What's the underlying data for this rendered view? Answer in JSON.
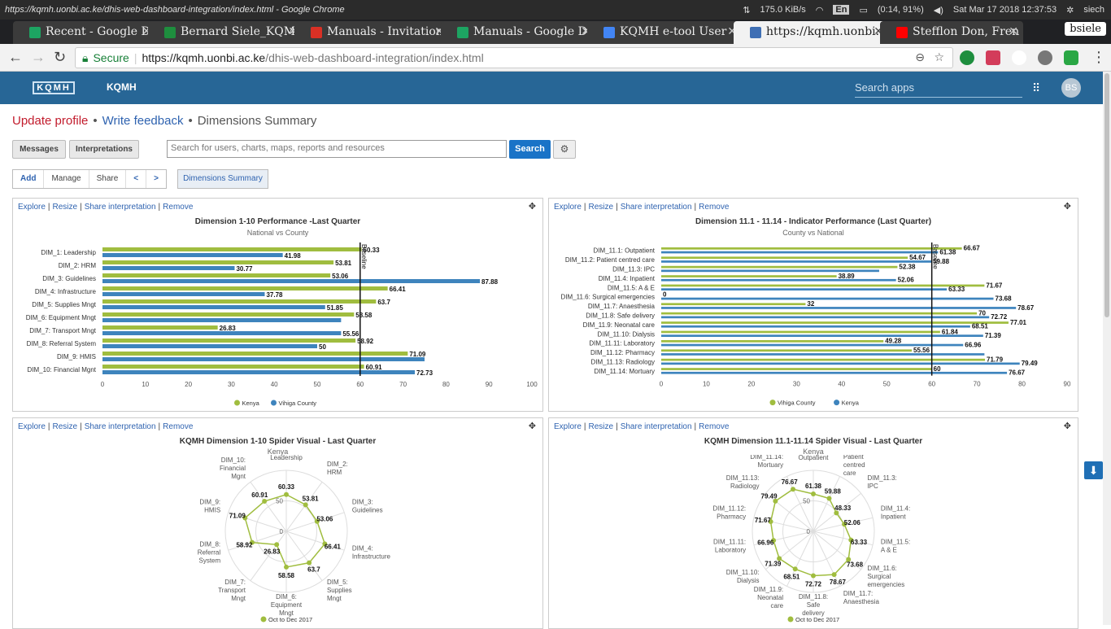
{
  "os": {
    "window_title": "https://kqmh.uonbi.ac.ke/dhis-web-dashboard-integration/index.html - Google Chrome",
    "net_speed": "175.0  KiB/s",
    "lang": "En",
    "battery": "(0:14,  91%)",
    "datetime": "Sat  Mar 17  2018   12:37:53",
    "user": "siech"
  },
  "browser": {
    "tabs": [
      {
        "label": "Recent - Google Dri",
        "color": "#1da462"
      },
      {
        "label": "Bernard Siele_KQMH",
        "color": "#1e8e3e"
      },
      {
        "label": "Manuals - Invitation",
        "color": "#d93025"
      },
      {
        "label": "Manuals - Google D",
        "color": "#1da462"
      },
      {
        "label": "KQMH e-tool User",
        "color": "#4285f4"
      },
      {
        "label": "https://kqmh.uonbi.a",
        "color": "#3f6fb4"
      },
      {
        "label": "Stefflon Don, Fren",
        "color": "#ff0000"
      }
    ],
    "profile": "bsiele",
    "secure_label": "Secure",
    "url_host": "https://kqmh.uonbi.ac.ke",
    "url_path": "/dhis-web-dashboard-integration/index.html"
  },
  "app": {
    "logo_text": "KQMH",
    "name": "KQMH",
    "search_placeholder": "Search apps",
    "avatar": "BS"
  },
  "page": {
    "update_profile": "Update profile",
    "write_feedback": "Write feedback",
    "current": "Dimensions Summary",
    "messages": "Messages",
    "interpretations": "Interpretations",
    "search_placeholder": "Search for users, charts, maps, reports and resources",
    "search_button": "Search",
    "add": "Add",
    "manage": "Manage",
    "share": "Share",
    "prev": "<",
    "next": ">",
    "dashboard_button": "Dimensions Summary"
  },
  "panel_links": {
    "explore": "Explore",
    "resize": "Resize",
    "share": "Share interpretation",
    "remove": "Remove"
  },
  "chart_data": [
    {
      "type": "bar",
      "title": "Dimension 1-10 Performance -Last Quarter",
      "subtitle": "National vs County",
      "categories": [
        "DIM_1: Leadership",
        "DIM_2: HRM",
        "DIM_3: Guidelines",
        "DIM_4: Infrastructure",
        "DIM_5: Supplies Mngt",
        "DIM_6: Equipment Mngt",
        "DIM_7: Transport Mngt",
        "DIM_8: Referral System",
        "DIM_9: HMIS",
        "DIM_10: Financial Mgnt"
      ],
      "series": [
        {
          "name": "Kenya",
          "color": "#a0bd3f",
          "values": [
            60.33,
            53.81,
            53.06,
            66.41,
            63.7,
            58.58,
            26.83,
            58.92,
            71.09,
            60.91
          ]
        },
        {
          "name": "Vihiga County",
          "color": "#3e84bd",
          "values": [
            41.98,
            30.77,
            87.88,
            37.78,
            51.85,
            55.56,
            55.56,
            50,
            75.0,
            72.73
          ]
        }
      ],
      "labels": {
        "Kenya": [
          "60.33",
          "53.81",
          "53.06",
          "66.41",
          "63.7",
          "58.58",
          "26.83",
          "58.92",
          "71.09",
          "60.91"
        ],
        "Vihiga County": [
          "41.98",
          "30.77",
          "87.88",
          "37.78",
          "51.85",
          "",
          "55.56",
          "50",
          "",
          "72.73"
        ]
      },
      "xlim": [
        0,
        100
      ],
      "xticks": [
        0,
        10,
        20,
        30,
        40,
        50,
        60,
        70,
        80,
        90,
        100
      ],
      "baseline": 60,
      "baseline_label": "Baseline",
      "legend": "bottom"
    },
    {
      "type": "bar",
      "title": "Dimension 11.1 - 11.14 - Indicator Performance (Last Quarter)",
      "subtitle": "County vs National",
      "categories": [
        "DIM_11.1: Outpatient",
        "DIM_11.2: Patient centred care",
        "DIM_11.3: IPC",
        "DIM_11.4: Inpatient",
        "DIM_11.5: A & E",
        "DIM_11.6: Surgical emergencies",
        "DIM_11.7: Anaesthesia",
        "DIM_11.8: Safe delivery",
        "DIM_11.9: Neonatal care",
        "DIM_11.10: Dialysis",
        "DIM_11.11: Laboratory",
        "DIM_11.12: Pharmacy",
        "DIM_11.13: Radiology",
        "DIM_11.14: Mortuary"
      ],
      "series": [
        {
          "name": "Vihiga County",
          "color": "#a0bd3f",
          "values": [
            66.67,
            54.67,
            52.38,
            38.89,
            71.67,
            0,
            32,
            70,
            77.01,
            61.84,
            49.28,
            55.56,
            71.79,
            60
          ]
        },
        {
          "name": "Kenya",
          "color": "#3e84bd",
          "values": [
            61.38,
            59.88,
            48.33,
            52.06,
            63.33,
            73.68,
            78.67,
            72.72,
            68.51,
            71.39,
            66.96,
            71.67,
            79.49,
            76.67
          ]
        }
      ],
      "labels": {
        "Vihiga County": [
          "66.67",
          "54.67",
          "52.38",
          "38.89",
          "71.67",
          "0",
          "32",
          "70",
          "77.01",
          "61.84",
          "49.28",
          "55.56",
          "71.79",
          "60"
        ],
        "Kenya": [
          "61.38",
          "59.88",
          "",
          "52.06",
          "63.33",
          "73.68",
          "78.67",
          "72.72",
          "68.51",
          "71.39",
          "66.96",
          "",
          "79.49",
          "76.67"
        ]
      },
      "xlim": [
        0,
        90
      ],
      "xticks": [
        0,
        10,
        20,
        30,
        40,
        50,
        60,
        70,
        80,
        90
      ],
      "baseline": 60,
      "baseline_label": "Baseline",
      "legend": "bottom"
    },
    {
      "type": "radar",
      "title": "KQMH Dimension 1-10 Spider Visual - Last Quarter",
      "subtitle": "Kenya",
      "axes": [
        [
          "DIM_1:",
          "Leadership"
        ],
        [
          "DIM_2:",
          "HRM"
        ],
        [
          "DIM_3:",
          "Guidelines"
        ],
        [
          "DIM_4:",
          "Infrastructure"
        ],
        [
          "DIM_5:",
          "Supplies",
          "Mngt"
        ],
        [
          "DIM_6:",
          "Equipment",
          "Mngt"
        ],
        [
          "DIM_7:",
          "Transport",
          "Mngt"
        ],
        [
          "DIM_8:",
          "Referral",
          "System"
        ],
        [
          "DIM_9:",
          "HMIS"
        ],
        [
          "DIM_10:",
          "Financial",
          "Mgnt"
        ]
      ],
      "values": [
        60.33,
        53.81,
        53.06,
        66.41,
        63.7,
        58.58,
        26.83,
        58.92,
        71.09,
        60.91
      ],
      "ring_labels": [
        "0",
        "50"
      ],
      "series_name": "Oct to Dec 2017",
      "color": "#a0bd3f"
    },
    {
      "type": "radar",
      "title": "KQMH Dimension 11.1-11.14 Spider Visual - Last Quarter",
      "subtitle": "Kenya",
      "axes": [
        [
          "DIM_11.1:",
          "Outpatient"
        ],
        [
          "DIM_11.2:",
          "Patient",
          "centred",
          "care"
        ],
        [
          "DIM_11.3:",
          "IPC"
        ],
        [
          "DIM_11.4:",
          "Inpatient"
        ],
        [
          "DIM_11.5:",
          "A & E"
        ],
        [
          "DIM_11.6:",
          "Surgical",
          "emergencies"
        ],
        [
          "DIM_11.7:",
          "Anaesthesia"
        ],
        [
          "DIM_11.8:",
          "Safe",
          "delivery"
        ],
        [
          "DIM_11.9:",
          "Neonatal",
          "care"
        ],
        [
          "DIM_11.10:",
          "Dialysis"
        ],
        [
          "DIM_11.11:",
          "Laboratory"
        ],
        [
          "DIM_11.12:",
          "Pharmacy"
        ],
        [
          "DIM_11.13:",
          "Radiology"
        ],
        [
          "DIM_11.14:",
          "Mortuary"
        ]
      ],
      "values": [
        61.38,
        59.88,
        48.33,
        52.06,
        63.33,
        73.68,
        78.67,
        72.72,
        68.51,
        71.39,
        66.96,
        71.67,
        79.49,
        76.67
      ],
      "ring_labels": [
        "0",
        "50"
      ],
      "series_name": "Oct to Dec 2017",
      "color": "#a0bd3f"
    }
  ]
}
